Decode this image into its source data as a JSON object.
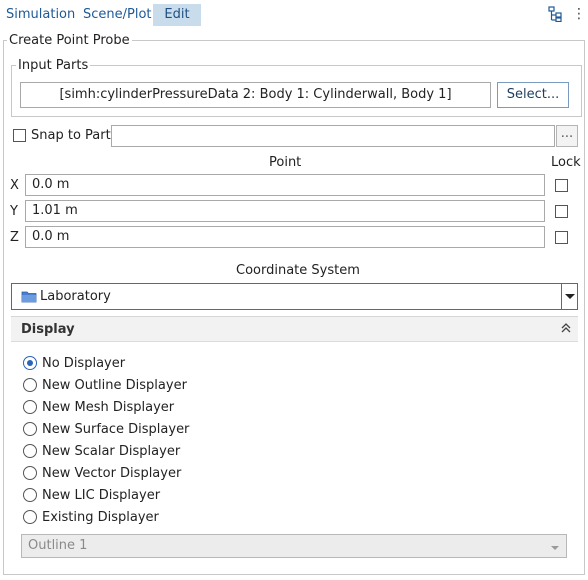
{
  "tabs": [
    {
      "label": "Simulation",
      "active": false
    },
    {
      "label": "Scene/Plot",
      "active": false
    },
    {
      "label": "Edit",
      "active": true
    }
  ],
  "panel": {
    "title": "Create Point Probe",
    "input_parts": {
      "label": "Input Parts",
      "value": "[simh:cylinderPressureData 2: Body 1: Cylinderwall, Body 1]",
      "select_label": "Select..."
    },
    "snap": {
      "label": "Snap to Part",
      "checked": false,
      "value": "",
      "browse_label": "..."
    },
    "point": {
      "header": "Point",
      "lock_header": "Lock",
      "rows": [
        {
          "axis": "X",
          "value": "0.0 m",
          "locked": false
        },
        {
          "axis": "Y",
          "value": "1.01 m",
          "locked": false
        },
        {
          "axis": "Z",
          "value": "0.0 m",
          "locked": false
        }
      ]
    },
    "coordinate_system": {
      "label": "Coordinate System",
      "value": "Laboratory"
    },
    "display": {
      "header": "Display",
      "options": [
        {
          "label": "No Displayer",
          "selected": true
        },
        {
          "label": "New Outline Displayer",
          "selected": false
        },
        {
          "label": "New Mesh Displayer",
          "selected": false
        },
        {
          "label": "New Surface Displayer",
          "selected": false
        },
        {
          "label": "New Scalar Displayer",
          "selected": false
        },
        {
          "label": "New Vector Displayer",
          "selected": false
        },
        {
          "label": "New LIC Displayer",
          "selected": false
        },
        {
          "label": "Existing Displayer",
          "selected": false
        }
      ],
      "existing_select": {
        "value": "Outline 1",
        "disabled": true
      }
    }
  },
  "colors": {
    "accent": "#1f5a96",
    "active_tab": "#c9dcec",
    "radio": "#2a64b8"
  }
}
